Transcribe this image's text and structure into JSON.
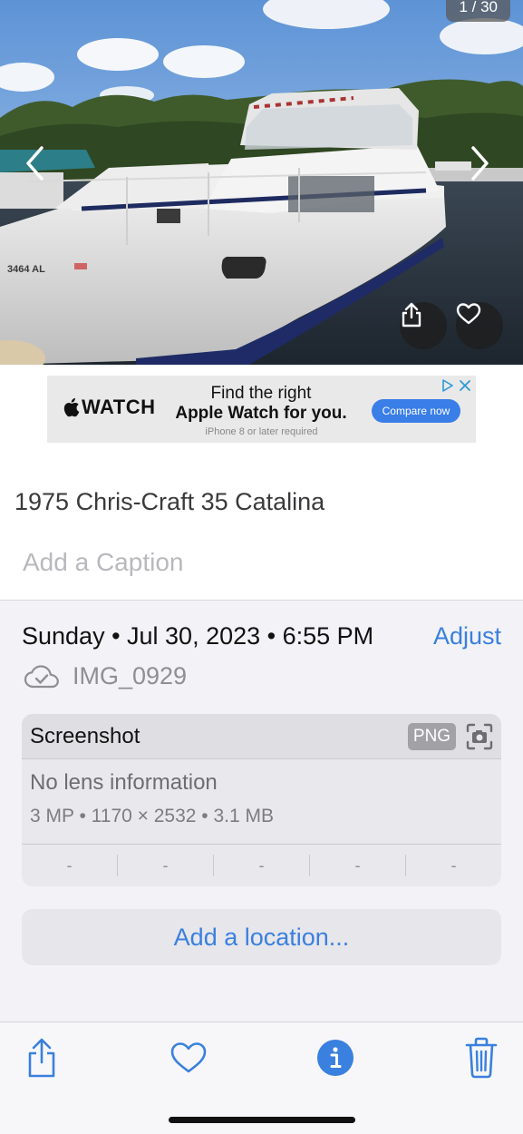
{
  "photo": {
    "counter": "1 / 30",
    "hull_number": "3464 AL"
  },
  "ad": {
    "brand": "WATCH",
    "headline_line1": "Find the right",
    "headline_line2": "Apple Watch for you.",
    "cta": "Compare now",
    "footnote": "iPhone 8 or later required"
  },
  "title": "1975 Chris-Craft 35 Catalina",
  "caption_placeholder": "Add a Caption",
  "info": {
    "datetime": "Sunday • Jul 30, 2023 • 6:55 PM",
    "adjust_label": "Adjust",
    "filename": "IMG_0929"
  },
  "metadata": {
    "type": "Screenshot",
    "format_badge": "PNG",
    "lens": "No lens information",
    "specs": "3 MP  •  1170 × 2532  •  3.1 MB",
    "exif": [
      "-",
      "-",
      "-",
      "-",
      "-"
    ]
  },
  "location_button": "Add a location...",
  "colors": {
    "accent": "#3a80de",
    "background": "#f2f2f7"
  },
  "toolbar": {
    "icons": [
      "share-icon",
      "heart-icon",
      "info-icon",
      "trash-icon"
    ]
  }
}
